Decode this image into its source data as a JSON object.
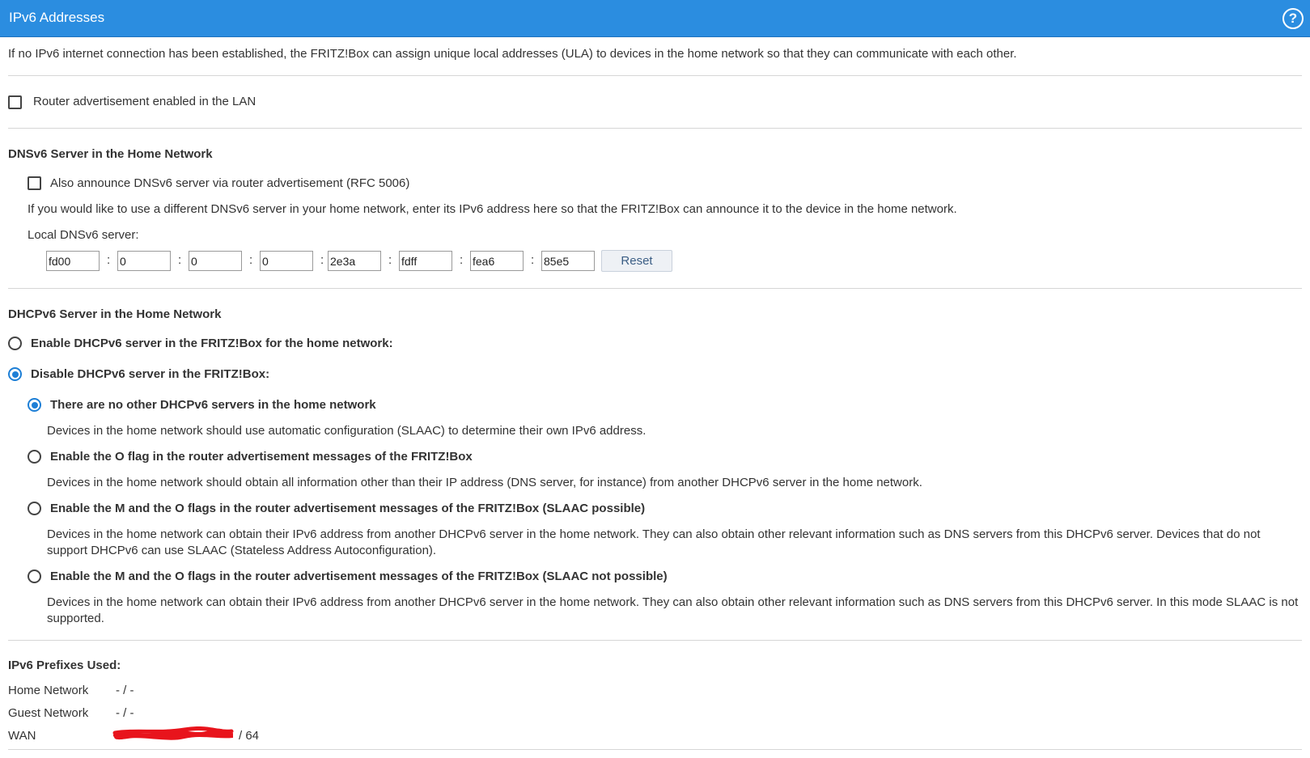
{
  "header": {
    "title": "IPv6 Addresses",
    "help_icon": "?"
  },
  "intro": "If no IPv6 internet connection has been established, the FRITZ!Box can assign unique local addresses (ULA) to devices in the home network so that they can communicate with each other.",
  "router_adv": {
    "label": "Router advertisement enabled in the LAN",
    "checked": false
  },
  "dnsv6": {
    "heading": "DNSv6 Server in the Home Network",
    "announce_label": "Also announce DNSv6 server via router advertisement (RFC 5006)",
    "announce_checked": false,
    "info": "If you would like to use a different DNSv6 server in your home network, enter its IPv6 address here so that the FRITZ!Box can announce it to the device in the home network.",
    "local_label": "Local DNSv6 server:",
    "separator": ":",
    "segments": [
      "fd00",
      "0",
      "0",
      "0",
      "2e3a",
      "fdff",
      "fea6",
      "85e5"
    ],
    "reset_label": "Reset"
  },
  "dhcpv6": {
    "heading": "DHCPv6 Server in the Home Network",
    "enable_label": "Enable DHCPv6 server in the FRITZ!Box for the home network:",
    "disable_label": "Disable DHCPv6 server in the FRITZ!Box:",
    "selected_main": "disable",
    "options": [
      {
        "label": "There are no other DHCPv6 servers in the home network",
        "desc": "Devices in the home network should use automatic configuration (SLAAC) to determine their own IPv6 address.",
        "checked": true
      },
      {
        "label": "Enable the O flag in the router advertisement messages of the FRITZ!Box",
        "desc": "Devices in the home network should obtain all information other than their IP address (DNS server, for instance) from another DHCPv6 server in the home network.",
        "checked": false
      },
      {
        "label": "Enable the M and the O flags in the router advertisement messages of the FRITZ!Box (SLAAC possible)",
        "desc": "Devices in the home network can obtain their IPv6 address from another DHCPv6 server in the home network. They can also obtain other relevant information such as DNS servers from this DHCPv6 server. Devices that do not support DHCPv6 can use SLAAC (Stateless Address Autoconfiguration).",
        "checked": false
      },
      {
        "label": "Enable the M and the O flags in the router advertisement messages of the FRITZ!Box (SLAAC not possible)",
        "desc": "Devices in the home network can obtain their IPv6 address from another DHCPv6 server in the home network. They can also obtain other relevant information such as DNS servers from this DHCPv6 server. In this mode SLAAC is not supported.",
        "checked": false
      }
    ]
  },
  "prefixes": {
    "heading": "IPv6 Prefixes Used:",
    "rows": [
      {
        "label": "Home Network",
        "value": "- / -"
      },
      {
        "label": "Guest Network",
        "value": "- / -"
      },
      {
        "label": "WAN",
        "value": "/ 64"
      }
    ]
  },
  "colors": {
    "header_bg": "#2b8de0",
    "radio_selected": "#1e7fd6",
    "redaction": "#e8141c"
  }
}
